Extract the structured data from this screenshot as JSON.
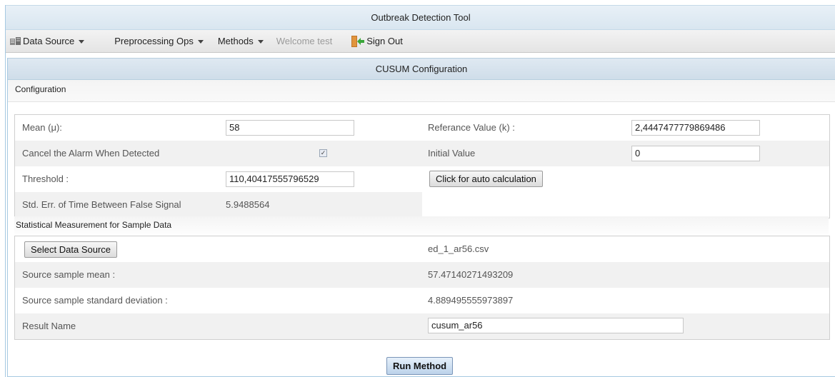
{
  "app": {
    "title": "Outbreak Detection Tool"
  },
  "menu": {
    "data_source": "Data Source",
    "preprocessing": "Preprocessing Ops",
    "methods": "Methods",
    "welcome": "Welcome test",
    "sign_out": "Sign Out"
  },
  "panel": {
    "title": "CUSUM Configuration"
  },
  "configuration": {
    "header": "Configuration",
    "mean_label": "Mean (μ):",
    "mean_value": "58",
    "reference_label": "Referance Value (k) :",
    "reference_value": "2,4447477779869486",
    "cancel_alarm_label": "Cancel the Alarm When Detected",
    "cancel_alarm_checked": true,
    "initial_value_label": "Initial Value",
    "initial_value": "0",
    "threshold_label": "Threshold :",
    "threshold_value": "110,40417555796529",
    "auto_calc_button": "Click for auto calculation",
    "std_err_label": "Std. Err. of Time Between False Signal",
    "std_err_value": "5.9488564"
  },
  "statistics": {
    "header": "Statistical Measurement for Sample Data",
    "select_source_button": "Select Data Source",
    "source_file": "ed_1_ar56.csv",
    "sample_mean_label": "Source sample mean :",
    "sample_mean_value": "57.47140271493209",
    "sample_std_label": "Source sample standard deviation :",
    "sample_std_value": "4.889495555973897",
    "result_name_label": "Result Name",
    "result_name_value": "cusum_ar56"
  },
  "run_button": "Run Method"
}
